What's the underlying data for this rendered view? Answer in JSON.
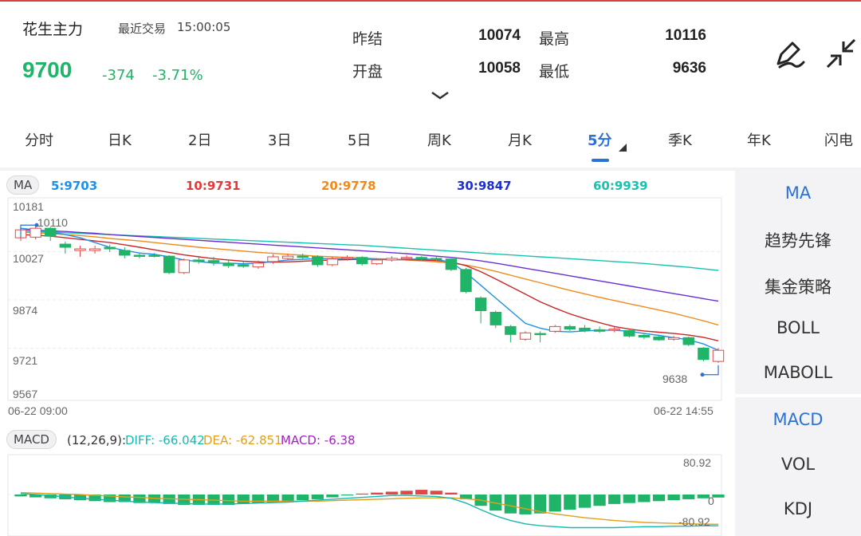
{
  "header": {
    "name": "花生主力",
    "trade_label": "最近交易",
    "trade_time": "15:00:05",
    "price": "9700",
    "change": "-374",
    "change_pct": "-3.71%",
    "stats": [
      {
        "label": "昨结",
        "value": "10074"
      },
      {
        "label": "最高",
        "value": "10116"
      },
      {
        "label": "开盘",
        "value": "10058"
      },
      {
        "label": "最低",
        "value": "9636"
      }
    ],
    "draw_icon": "pencil-draw-icon",
    "collapse_icon": "collapse-arrows-icon"
  },
  "tabs": [
    {
      "label": "分时"
    },
    {
      "label": "日K"
    },
    {
      "label": "2日"
    },
    {
      "label": "3日"
    },
    {
      "label": "5日"
    },
    {
      "label": "周K"
    },
    {
      "label": "月K"
    },
    {
      "label": "5分",
      "active": true
    },
    {
      "label": "季K"
    },
    {
      "label": "年K"
    },
    {
      "label": "闪电"
    }
  ],
  "ma_legend": {
    "label": "MA",
    "items": [
      {
        "text": "5:9703",
        "color": "#1e90e6"
      },
      {
        "text": "10:9731",
        "color": "#e23a3a"
      },
      {
        "text": "20:9778",
        "color": "#f08a1c"
      },
      {
        "text": "30:9847",
        "color": "#1d2fd0"
      },
      {
        "text": "60:9939",
        "color": "#18c2b0"
      }
    ]
  },
  "macd_legend": {
    "label": "MACD",
    "params": "(12,26,9):",
    "diff": "DIFF: -66.042",
    "dea": "DEA: -62.851",
    "macd": "MACD: -6.38",
    "diff_color": "#18b8b0",
    "dea_color": "#e0a01c",
    "macd_color": "#a020c0"
  },
  "main_chart": {
    "y_ticks": [
      "10181",
      "10027",
      "9874",
      "9721",
      "9567"
    ],
    "x_start": "06-22 09:00",
    "x_end": "06-22 14:55",
    "high_marker": "10110",
    "low_marker": "9638",
    "up_color": "#e04848",
    "down_color": "#1fb468"
  },
  "macd_chart": {
    "top_label": "80.92",
    "zero_label": "0",
    "bottom_label": "-80.92"
  },
  "chart_data": {
    "type": "candlestick",
    "ylim": [
      9567,
      10181
    ],
    "candles": [
      {
        "o": 10070,
        "c": 10095,
        "h": 10110,
        "l": 10060
      },
      {
        "o": 10072,
        "c": 10100,
        "h": 10110,
        "l": 10065
      },
      {
        "o": 10100,
        "c": 10075,
        "h": 10105,
        "l": 10060
      },
      {
        "o": 10050,
        "c": 10040,
        "h": 10058,
        "l": 10020
      },
      {
        "o": 10030,
        "c": 10035,
        "h": 10045,
        "l": 10010
      },
      {
        "o": 10030,
        "c": 10035,
        "h": 10045,
        "l": 10020
      },
      {
        "o": 10040,
        "c": 10035,
        "h": 10048,
        "l": 10025
      },
      {
        "o": 10030,
        "c": 10015,
        "h": 10040,
        "l": 10005
      },
      {
        "o": 10015,
        "c": 10012,
        "h": 10022,
        "l": 10005
      },
      {
        "o": 10015,
        "c": 10012,
        "h": 10022,
        "l": 10008
      },
      {
        "o": 10012,
        "c": 9960,
        "h": 10015,
        "l": 9955
      },
      {
        "o": 9960,
        "c": 10000,
        "h": 10005,
        "l": 9955
      },
      {
        "o": 10000,
        "c": 9995,
        "h": 10010,
        "l": 9988
      },
      {
        "o": 9998,
        "c": 9993,
        "h": 10010,
        "l": 9982
      },
      {
        "o": 9990,
        "c": 9982,
        "h": 9998,
        "l": 9975
      },
      {
        "o": 9985,
        "c": 9980,
        "h": 9995,
        "l": 9975
      },
      {
        "o": 9978,
        "c": 9990,
        "h": 9998,
        "l": 9972
      },
      {
        "o": 9995,
        "c": 10010,
        "h": 10018,
        "l": 9988
      },
      {
        "o": 10005,
        "c": 10012,
        "h": 10020,
        "l": 10000
      },
      {
        "o": 10012,
        "c": 10008,
        "h": 10020,
        "l": 10002
      },
      {
        "o": 10010,
        "c": 9985,
        "h": 10015,
        "l": 9978
      },
      {
        "o": 9985,
        "c": 10003,
        "h": 10010,
        "l": 9980
      },
      {
        "o": 10005,
        "c": 10008,
        "h": 10015,
        "l": 9998
      },
      {
        "o": 10008,
        "c": 9988,
        "h": 10012,
        "l": 9982
      },
      {
        "o": 9988,
        "c": 10000,
        "h": 10005,
        "l": 9984
      },
      {
        "o": 10000,
        "c": 10005,
        "h": 10012,
        "l": 9995
      },
      {
        "o": 10005,
        "c": 10008,
        "h": 10014,
        "l": 9998
      },
      {
        "o": 10008,
        "c": 10004,
        "h": 10012,
        "l": 9998
      },
      {
        "o": 10005,
        "c": 10003,
        "h": 10010,
        "l": 9996
      },
      {
        "o": 10003,
        "c": 9970,
        "h": 10005,
        "l": 9965
      },
      {
        "o": 9970,
        "c": 9900,
        "h": 9975,
        "l": 9895
      },
      {
        "o": 9880,
        "c": 9840,
        "h": 9885,
        "l": 9800
      },
      {
        "o": 9835,
        "c": 9795,
        "h": 9840,
        "l": 9785
      },
      {
        "o": 9790,
        "c": 9765,
        "h": 9795,
        "l": 9740
      },
      {
        "o": 9750,
        "c": 9770,
        "h": 9775,
        "l": 9745
      },
      {
        "o": 9768,
        "c": 9767,
        "h": 9775,
        "l": 9740
      },
      {
        "o": 9775,
        "c": 9790,
        "h": 9795,
        "l": 9770
      },
      {
        "o": 9790,
        "c": 9782,
        "h": 9796,
        "l": 9776
      },
      {
        "o": 9785,
        "c": 9778,
        "h": 9795,
        "l": 9772
      },
      {
        "o": 9780,
        "c": 9775,
        "h": 9790,
        "l": 9770
      },
      {
        "o": 9780,
        "c": 9782,
        "h": 9788,
        "l": 9772
      },
      {
        "o": 9777,
        "c": 9760,
        "h": 9780,
        "l": 9755
      },
      {
        "o": 9762,
        "c": 9757,
        "h": 9768,
        "l": 9750
      },
      {
        "o": 9757,
        "c": 9748,
        "h": 9762,
        "l": 9745
      },
      {
        "o": 9750,
        "c": 9755,
        "h": 9760,
        "l": 9745
      },
      {
        "o": 9755,
        "c": 9733,
        "h": 9758,
        "l": 9728
      },
      {
        "o": 9722,
        "c": 9686,
        "h": 9725,
        "l": 9680
      },
      {
        "o": 9680,
        "c": 9715,
        "h": 9722,
        "l": 9675
      }
    ],
    "ma5": [
      10100,
      10095,
      10088,
      10080,
      10070,
      10055,
      10040,
      10030,
      10022,
      10018,
      10010,
      10000,
      9995,
      9990,
      9990,
      9988,
      9990,
      9995,
      10000,
      10002,
      10004,
      10004,
      10004,
      10003,
      10002,
      10000,
      10002,
      10003,
      10002,
      9992,
      9960,
      9920,
      9880,
      9840,
      9800,
      9785,
      9775,
      9773,
      9776,
      9778,
      9778,
      9775,
      9768,
      9762,
      9755,
      9748,
      9735,
      9715
    ],
    "ma10": [
      10080,
      10078,
      10075,
      10070,
      10065,
      10060,
      10055,
      10048,
      10040,
      10032,
      10024,
      10016,
      10010,
      10004,
      10000,
      9996,
      9994,
      9993,
      9994,
      9996,
      9998,
      10000,
      10001,
      10002,
      10002,
      10001,
      10001,
      10000,
      9998,
      9994,
      9982,
      9963,
      9940,
      9916,
      9892,
      9868,
      9848,
      9830,
      9815,
      9802,
      9790,
      9782,
      9776,
      9772,
      9768,
      9763,
      9756,
      9745
    ],
    "ma20": [
      10088,
      10086,
      10083,
      10080,
      10077,
      10073,
      10068,
      10064,
      10060,
      10055,
      10050,
      10045,
      10040,
      10036,
      10032,
      10028,
      10024,
      10021,
      10018,
      10015,
      10012,
      10010,
      10008,
      10006,
      10004,
      10002,
      10000,
      9997,
      9994,
      9990,
      9984,
      9975,
      9964,
      9952,
      9940,
      9928,
      9916,
      9904,
      9893,
      9882,
      9872,
      9862,
      9852,
      9842,
      9832,
      9820,
      9808,
      9795
    ],
    "ma30": [
      10095,
      10094,
      10092,
      10090,
      10087,
      10084,
      10080,
      10077,
      10074,
      10071,
      10068,
      10065,
      10062,
      10059,
      10056,
      10053,
      10050,
      10047,
      10044,
      10041,
      10038,
      10035,
      10032,
      10029,
      10026,
      10023,
      10020,
      10016,
      10012,
      10008,
      10003,
      9997,
      9990,
      9982,
      9974,
      9966,
      9958,
      9950,
      9942,
      9934,
      9926,
      9918,
      9910,
      9902,
      9894,
      9886,
      9878,
      9870
    ],
    "ma60": [
      10090,
      10089,
      10088,
      10086,
      10084,
      10082,
      10080,
      10078,
      10076,
      10074,
      10072,
      10070,
      10068,
      10066,
      10064,
      10062,
      10060,
      10058,
      10056,
      10054,
      10052,
      10050,
      10048,
      10046,
      10043,
      10040,
      10037,
      10034,
      10031,
      10028,
      10025,
      10022,
      10019,
      10016,
      10013,
      10010,
      10007,
      10004,
      10001,
      9998,
      9995,
      9992,
      9989,
      9985,
      9981,
      9977,
      9972,
      9967
    ],
    "macd_ylim": [
      -80.92,
      80.92
    ],
    "macd_hist": [
      -4,
      -6,
      -8,
      -10,
      -12,
      -14,
      -16,
      -16,
      -18,
      -18,
      -20,
      -22,
      -22,
      -22,
      -22,
      -20,
      -18,
      -16,
      -14,
      -12,
      -10,
      -6,
      -2,
      2,
      4,
      6,
      8,
      10,
      8,
      4,
      -10,
      -24,
      -34,
      -40,
      -42,
      -40,
      -36,
      -32,
      -28,
      -24,
      -20,
      -18,
      -16,
      -14,
      -12,
      -10,
      -8,
      -6.38
    ],
    "diff": [
      2,
      0,
      -2,
      -5,
      -8,
      -10,
      -12,
      -14,
      -16,
      -17,
      -18,
      -19,
      -20,
      -20,
      -20,
      -19,
      -18,
      -17,
      -16,
      -14,
      -12,
      -10,
      -8,
      -6,
      -4,
      -2,
      -2,
      -3,
      -4,
      -8,
      -18,
      -32,
      -45,
      -55,
      -62,
      -66,
      -68,
      -70,
      -70,
      -70,
      -70,
      -69,
      -68,
      -68,
      -67,
      -67,
      -66,
      -66.042
    ],
    "dea": [
      4,
      3,
      2,
      1,
      0,
      -2,
      -3,
      -5,
      -6,
      -8,
      -9,
      -10,
      -11,
      -12,
      -13,
      -14,
      -14,
      -14,
      -14,
      -14,
      -14,
      -13,
      -12,
      -11,
      -10,
      -9,
      -8,
      -7,
      -7,
      -7,
      -9,
      -12,
      -18,
      -24,
      -30,
      -36,
      -41,
      -45,
      -49,
      -52,
      -55,
      -57,
      -59,
      -60,
      -61,
      -62,
      -62.5,
      -62.851
    ]
  },
  "sidebar_top": [
    {
      "label": "MA",
      "active": true
    },
    {
      "label": "趋势先锋"
    },
    {
      "label": "集金策略"
    },
    {
      "label": "BOLL"
    },
    {
      "label": "MABOLL"
    }
  ],
  "sidebar_bottom": [
    {
      "label": "MACD",
      "active": true
    },
    {
      "label": "VOL"
    },
    {
      "label": "KDJ"
    }
  ]
}
